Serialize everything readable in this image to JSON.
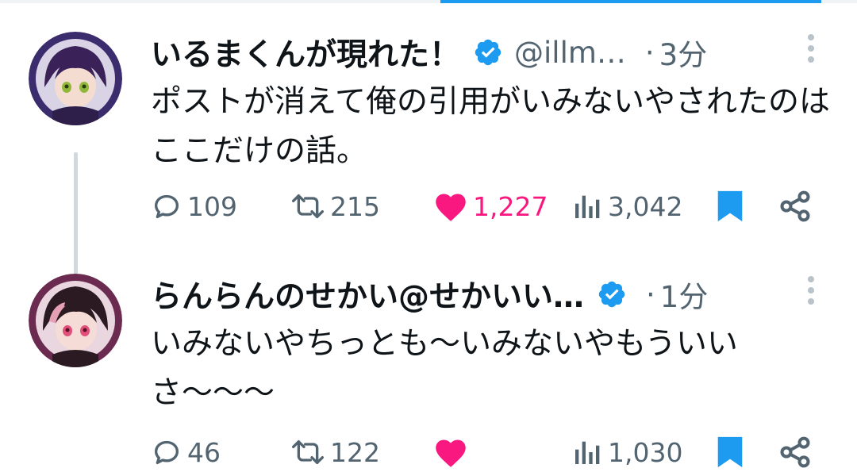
{
  "tweets": [
    {
      "display_name": "いるまくんが現れた！",
      "handle": "@illm…",
      "separator": "·",
      "time": "3分",
      "text": "ポストが消えて俺の引用がいみないやされたのはここだけの話。",
      "avatar_colors": {
        "ring": "#3b2c6e",
        "hair": "#3a2258",
        "face": "#f4ddd0",
        "eyes": "#8fb83a"
      },
      "stats": {
        "replies": "109",
        "retweets": "215",
        "likes": "1,227",
        "views": "3,042"
      },
      "liked": true,
      "bookmarked": true,
      "has_thread_line": true
    },
    {
      "display_name": "らんらんのせかい@せかいい…",
      "handle": "",
      "separator": "·",
      "time": "1分",
      "text": "いみないやちっとも〜いみないやもういいさ〜〜〜",
      "avatar_colors": {
        "ring": "#6b2a4f",
        "hair": "#2b1a22",
        "face": "#f6dcd6",
        "eyes": "#e0507a"
      },
      "stats": {
        "replies": "46",
        "retweets": "122",
        "likes": "",
        "views": "1,030"
      },
      "liked": true,
      "bookmarked": true,
      "has_thread_line": false
    }
  ],
  "colors": {
    "like": "#f91880",
    "accent": "#1d9bf0",
    "secondary_text": "#536471",
    "verified": "#1d9bf0"
  },
  "icons": {
    "reply": "reply-icon",
    "retweet": "retweet-icon",
    "like": "heart-icon",
    "views": "views-icon",
    "bookmark": "bookmark-icon",
    "share": "share-icon",
    "more": "more-vertical-icon",
    "verified": "verified-badge-icon"
  }
}
